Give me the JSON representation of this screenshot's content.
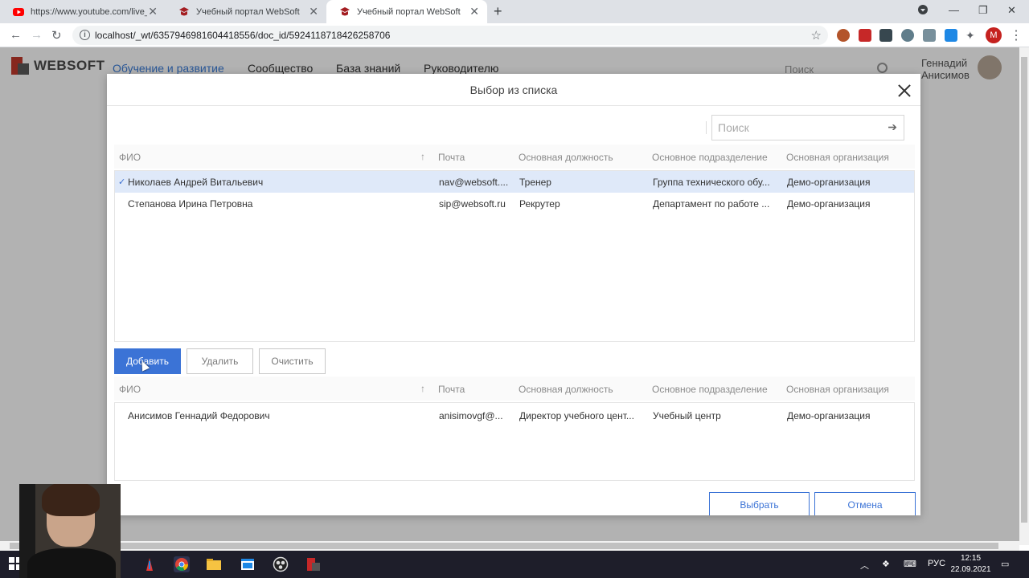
{
  "browser": {
    "tabs": [
      {
        "title": "https://www.youtube.com/live_c",
        "icon": "youtube-icon"
      },
      {
        "title": "Учебный портал WebSoft",
        "icon": "websoft-icon"
      },
      {
        "title": "Учебный портал WebSoft",
        "icon": "websoft-icon"
      }
    ],
    "url": "localhost/_wt/6357946981604418556/doc_id/5924118718426258706",
    "profile_initial": "M"
  },
  "site": {
    "logo": "WEBSOFT",
    "nav": [
      "Обучение и развитие",
      "Сообщество",
      "База знаний",
      "Руководителю"
    ],
    "search_placeholder": "Поиск",
    "user_first": "Геннадий",
    "user_last": "Анисимов"
  },
  "modal": {
    "title": "Выбор из списка",
    "search_placeholder": "Поиск",
    "columns": [
      "ФИО",
      "Почта",
      "Основная должность",
      "Основное подразделение",
      "Основная организация"
    ],
    "available": [
      {
        "name": "Николаев Андрей Витальевич",
        "email": "nav@websoft....",
        "position": "Тренер",
        "department": "Группа технического обу...",
        "org": "Демо-организация",
        "selected": true
      },
      {
        "name": "Степанова Ирина Петровна",
        "email": "sip@websoft.ru",
        "position": "Рекрутер",
        "department": "Департамент по работе ...",
        "org": "Демо-организация",
        "selected": false
      }
    ],
    "buttons": {
      "add": "Добавить",
      "remove": "Удалить",
      "clear": "Очистить",
      "choose": "Выбрать",
      "cancel": "Отмена"
    },
    "chosen": [
      {
        "name": "Анисимов Геннадий Федорович",
        "email": "anisimovgf@...",
        "position": "Директор учебного цент...",
        "department": "Учебный центр",
        "org": "Демо-организация"
      }
    ]
  },
  "taskbar": {
    "lang": "РУС",
    "time": "12:15",
    "date": "22.09.2021"
  },
  "colors": {
    "accent": "#3b73d6",
    "selected_row": "#dfe9f9",
    "brand_red": "#c0392b"
  }
}
